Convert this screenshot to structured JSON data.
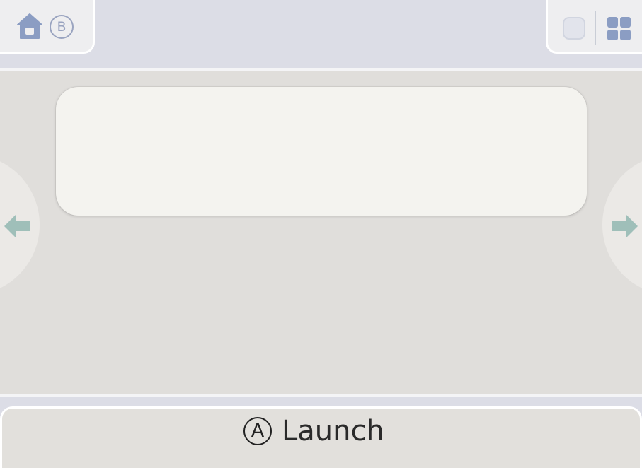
{
  "top_bar": {
    "home_icon": "home-icon",
    "back_hint": {
      "glyph": "B",
      "icon": "b-button-glyph"
    },
    "square_icon": "square-icon",
    "grid_icon": "grid-icon"
  },
  "main": {
    "prev_icon": "arrow-left-icon",
    "next_icon": "arrow-right-icon"
  },
  "bottom_bar": {
    "launch": {
      "glyph": "A",
      "label": "Launch"
    }
  },
  "colors": {
    "top_bar_bg": "#dcdde6",
    "main_bg": "#e0dedb",
    "card_bg": "#f4f3ef",
    "icon_blue": "#8b9dc3",
    "arrow_teal": "#9fbfb9",
    "text_dark": "#2a2a2a"
  }
}
